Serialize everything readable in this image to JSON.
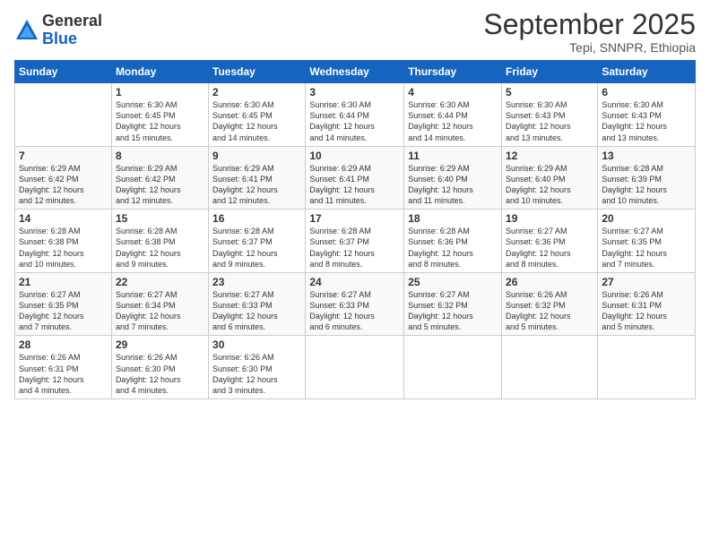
{
  "logo": {
    "general": "General",
    "blue": "Blue"
  },
  "title": "September 2025",
  "subtitle": "Tepi, SNNPR, Ethiopia",
  "days_header": [
    "Sunday",
    "Monday",
    "Tuesday",
    "Wednesday",
    "Thursday",
    "Friday",
    "Saturday"
  ],
  "weeks": [
    [
      {
        "num": "",
        "info": ""
      },
      {
        "num": "1",
        "info": "Sunrise: 6:30 AM\nSunset: 6:45 PM\nDaylight: 12 hours\nand 15 minutes."
      },
      {
        "num": "2",
        "info": "Sunrise: 6:30 AM\nSunset: 6:45 PM\nDaylight: 12 hours\nand 14 minutes."
      },
      {
        "num": "3",
        "info": "Sunrise: 6:30 AM\nSunset: 6:44 PM\nDaylight: 12 hours\nand 14 minutes."
      },
      {
        "num": "4",
        "info": "Sunrise: 6:30 AM\nSunset: 6:44 PM\nDaylight: 12 hours\nand 14 minutes."
      },
      {
        "num": "5",
        "info": "Sunrise: 6:30 AM\nSunset: 6:43 PM\nDaylight: 12 hours\nand 13 minutes."
      },
      {
        "num": "6",
        "info": "Sunrise: 6:30 AM\nSunset: 6:43 PM\nDaylight: 12 hours\nand 13 minutes."
      }
    ],
    [
      {
        "num": "7",
        "info": "Sunrise: 6:29 AM\nSunset: 6:42 PM\nDaylight: 12 hours\nand 12 minutes."
      },
      {
        "num": "8",
        "info": "Sunrise: 6:29 AM\nSunset: 6:42 PM\nDaylight: 12 hours\nand 12 minutes."
      },
      {
        "num": "9",
        "info": "Sunrise: 6:29 AM\nSunset: 6:41 PM\nDaylight: 12 hours\nand 12 minutes."
      },
      {
        "num": "10",
        "info": "Sunrise: 6:29 AM\nSunset: 6:41 PM\nDaylight: 12 hours\nand 11 minutes."
      },
      {
        "num": "11",
        "info": "Sunrise: 6:29 AM\nSunset: 6:40 PM\nDaylight: 12 hours\nand 11 minutes."
      },
      {
        "num": "12",
        "info": "Sunrise: 6:29 AM\nSunset: 6:40 PM\nDaylight: 12 hours\nand 10 minutes."
      },
      {
        "num": "13",
        "info": "Sunrise: 6:28 AM\nSunset: 6:39 PM\nDaylight: 12 hours\nand 10 minutes."
      }
    ],
    [
      {
        "num": "14",
        "info": "Sunrise: 6:28 AM\nSunset: 6:38 PM\nDaylight: 12 hours\nand 10 minutes."
      },
      {
        "num": "15",
        "info": "Sunrise: 6:28 AM\nSunset: 6:38 PM\nDaylight: 12 hours\nand 9 minutes."
      },
      {
        "num": "16",
        "info": "Sunrise: 6:28 AM\nSunset: 6:37 PM\nDaylight: 12 hours\nand 9 minutes."
      },
      {
        "num": "17",
        "info": "Sunrise: 6:28 AM\nSunset: 6:37 PM\nDaylight: 12 hours\nand 8 minutes."
      },
      {
        "num": "18",
        "info": "Sunrise: 6:28 AM\nSunset: 6:36 PM\nDaylight: 12 hours\nand 8 minutes."
      },
      {
        "num": "19",
        "info": "Sunrise: 6:27 AM\nSunset: 6:36 PM\nDaylight: 12 hours\nand 8 minutes."
      },
      {
        "num": "20",
        "info": "Sunrise: 6:27 AM\nSunset: 6:35 PM\nDaylight: 12 hours\nand 7 minutes."
      }
    ],
    [
      {
        "num": "21",
        "info": "Sunrise: 6:27 AM\nSunset: 6:35 PM\nDaylight: 12 hours\nand 7 minutes."
      },
      {
        "num": "22",
        "info": "Sunrise: 6:27 AM\nSunset: 6:34 PM\nDaylight: 12 hours\nand 7 minutes."
      },
      {
        "num": "23",
        "info": "Sunrise: 6:27 AM\nSunset: 6:33 PM\nDaylight: 12 hours\nand 6 minutes."
      },
      {
        "num": "24",
        "info": "Sunrise: 6:27 AM\nSunset: 6:33 PM\nDaylight: 12 hours\nand 6 minutes."
      },
      {
        "num": "25",
        "info": "Sunrise: 6:27 AM\nSunset: 6:32 PM\nDaylight: 12 hours\nand 5 minutes."
      },
      {
        "num": "26",
        "info": "Sunrise: 6:26 AM\nSunset: 6:32 PM\nDaylight: 12 hours\nand 5 minutes."
      },
      {
        "num": "27",
        "info": "Sunrise: 6:26 AM\nSunset: 6:31 PM\nDaylight: 12 hours\nand 5 minutes."
      }
    ],
    [
      {
        "num": "28",
        "info": "Sunrise: 6:26 AM\nSunset: 6:31 PM\nDaylight: 12 hours\nand 4 minutes."
      },
      {
        "num": "29",
        "info": "Sunrise: 6:26 AM\nSunset: 6:30 PM\nDaylight: 12 hours\nand 4 minutes."
      },
      {
        "num": "30",
        "info": "Sunrise: 6:26 AM\nSunset: 6:30 PM\nDaylight: 12 hours\nand 3 minutes."
      },
      {
        "num": "",
        "info": ""
      },
      {
        "num": "",
        "info": ""
      },
      {
        "num": "",
        "info": ""
      },
      {
        "num": "",
        "info": ""
      }
    ]
  ]
}
